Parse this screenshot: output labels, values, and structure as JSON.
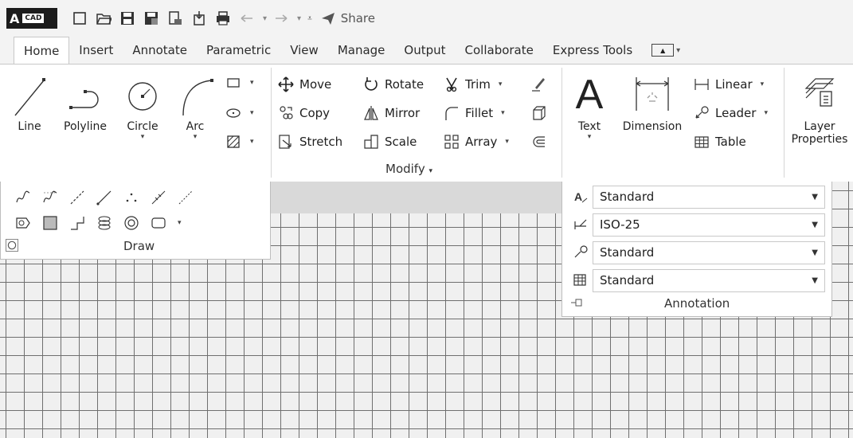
{
  "quick_access": {
    "logo_letter": "A",
    "logo_badge": "CAD",
    "share_label": "Share"
  },
  "tabs": [
    {
      "label": "Home",
      "active": true
    },
    {
      "label": "Insert"
    },
    {
      "label": "Annotate"
    },
    {
      "label": "Parametric"
    },
    {
      "label": "View"
    },
    {
      "label": "Manage"
    },
    {
      "label": "Output"
    },
    {
      "label": "Collaborate"
    },
    {
      "label": "Express Tools"
    }
  ],
  "draw": {
    "line": "Line",
    "polyline": "Polyline",
    "circle": "Circle",
    "arc": "Arc",
    "panel_title": "Draw"
  },
  "modify": {
    "move": "Move",
    "copy": "Copy",
    "stretch": "Stretch",
    "rotate": "Rotate",
    "mirror": "Mirror",
    "scale": "Scale",
    "trim": "Trim",
    "fillet": "Fillet",
    "array": "Array",
    "panel_title": "Modify"
  },
  "annotation": {
    "text": "Text",
    "dimension": "Dimension",
    "linear": "Linear",
    "leader": "Leader",
    "table": "Table",
    "panel_title": "Annotation",
    "text_style": "Standard",
    "dim_style": "ISO-25",
    "mleader_style": "Standard",
    "table_style": "Standard"
  },
  "layers": {
    "layer_properties_line1": "Layer",
    "layer_properties_line2": "Properties"
  },
  "colors": {
    "ribbon_bg": "#ffffff",
    "canvas_bg": "#f0f0f0",
    "grid_line": "#6f6f6f",
    "title_bar": "#f3f3f3"
  }
}
